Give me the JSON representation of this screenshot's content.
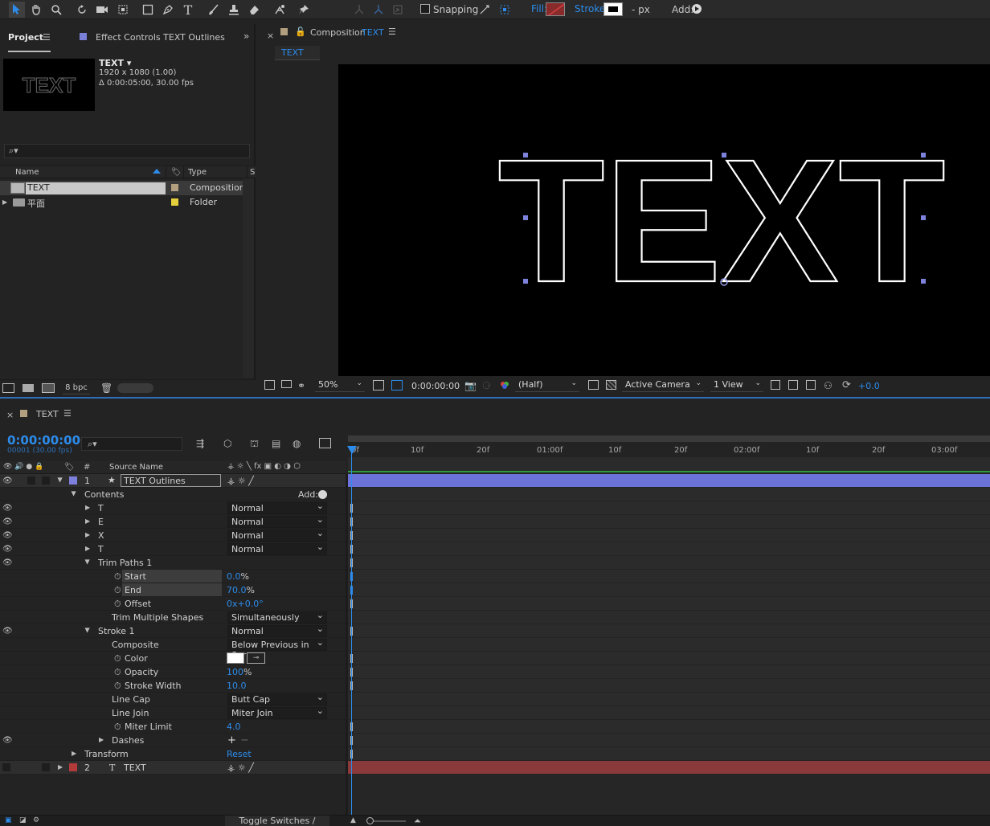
{
  "toolbar": {
    "snapping_label": "Snapping",
    "fill_label": "Fill:",
    "stroke_label": "Stroke:",
    "stroke_px": "- px",
    "add_label": "Add:"
  },
  "project": {
    "tab_project": "Project",
    "tab_effect": "Effect Controls TEXT Outlines",
    "item_name": "TEXT ▾",
    "item_size": "1920 x 1080 (1.00)",
    "item_duration": "Δ 0:00:05:00, 30.00 fps",
    "thumb_text": "TEXT",
    "col_name": "Name",
    "col_type": "Type",
    "col_size": "S",
    "rows": [
      {
        "name": "TEXT",
        "type": "Composition",
        "color": "#b29f7f"
      },
      {
        "name": "平面",
        "type": "Folder",
        "color": "#e6cf3c"
      }
    ],
    "bpc": "8 bpc"
  },
  "comp": {
    "tab_prefix": "Composition",
    "tab_name": "TEXT",
    "crumb": "TEXT",
    "viewer_text": "TEXT",
    "zoom": "50%",
    "timecode": "0:00:00:00",
    "resolution": "(Half)",
    "camera": "Active Camera",
    "views": "1 View",
    "exposure": "+0.0"
  },
  "timeline": {
    "tab_name": "TEXT",
    "timecode": "0:00:00:00",
    "frame_info": "00001 (30.00 fps)",
    "col_hash": "#",
    "col_source": "Source Name",
    "ruler": [
      "0f",
      "10f",
      "20f",
      "01:00f",
      "10f",
      "20f",
      "02:00f",
      "10f",
      "20f",
      "03:00f"
    ],
    "layer1_num": "1",
    "layer1_name": "TEXT Outlines",
    "contents": "Contents",
    "add": "Add:",
    "groups": [
      {
        "name": "T",
        "mode": "Normal"
      },
      {
        "name": "E",
        "mode": "Normal"
      },
      {
        "name": "X",
        "mode": "Normal"
      },
      {
        "name": "T",
        "mode": "Normal"
      }
    ],
    "trim": "Trim Paths 1",
    "start_label": "Start",
    "start_value": "0.0",
    "end_label": "End",
    "end_value": "70.0",
    "pct": "%",
    "offset_label": "Offset",
    "offset_value": "0x+0.0°",
    "trim_multi_label": "Trim Multiple Shapes",
    "trim_multi_value": "Simultaneously",
    "stroke": "Stroke 1",
    "stroke_mode": "Normal",
    "composite_label": "Composite",
    "composite_value": "Below Previous in Sar",
    "color_label": "Color",
    "opacity_label": "Opacity",
    "opacity_value": "100",
    "width_label": "Stroke Width",
    "width_value": "10.0",
    "cap_label": "Line Cap",
    "cap_value": "Butt Cap",
    "join_label": "Line Join",
    "join_value": "Miter Join",
    "miter_label": "Miter Limit",
    "miter_value": "4.0",
    "dashes": "Dashes",
    "transform": "Transform",
    "reset": "Reset",
    "layer2_num": "2",
    "layer2_name": "TEXT",
    "toggle": "Toggle Switches / Modes"
  },
  "colors": {
    "accent": "#2d8ceb",
    "layer1": "#7d7fdc",
    "layer2": "#b33a3a"
  }
}
